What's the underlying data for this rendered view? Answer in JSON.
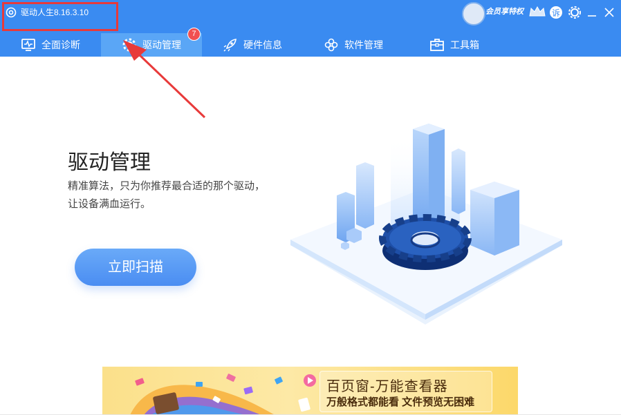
{
  "app": {
    "title": "驱动人生8.16.3.10"
  },
  "tabs": [
    {
      "label": "全面诊断",
      "icon": "monitor-icon"
    },
    {
      "label": "驱动管理",
      "icon": "gear-icon",
      "badge": "7",
      "active": true
    },
    {
      "label": "硬件信息",
      "icon": "rocket-icon"
    },
    {
      "label": "软件管理",
      "icon": "flower-icon"
    },
    {
      "label": "工具箱",
      "icon": "toolbox-icon"
    }
  ],
  "member": {
    "label": "会员享特权"
  },
  "titlebar_icons": [
    "avatar-icon",
    "crown-icon",
    "feedback-icon",
    "settings-icon",
    "minimize-icon",
    "close-icon"
  ],
  "feedback": {
    "label": "诉"
  },
  "main": {
    "headline": "驱动管理",
    "desc_line1": "精准算法，只为你推荐最合适的那个驱动，",
    "desc_line2": "让设备满血运行。",
    "scan_button": "立即扫描"
  },
  "banner": {
    "title": "百页窗-万能查看器",
    "subtitle": "万般格式都能看  文件预览无困难"
  },
  "colors": {
    "primary": "#3a8bf1",
    "active_tab": "#5aa6f6",
    "badge": "#f05050",
    "annotation": "#e83a3a"
  }
}
